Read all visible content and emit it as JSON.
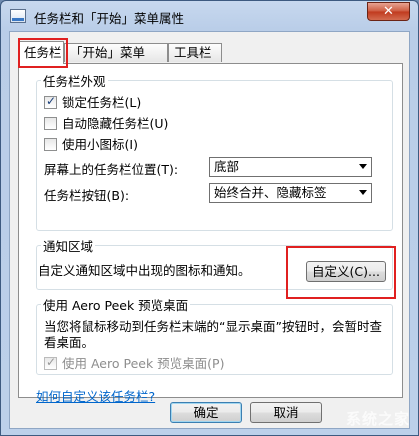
{
  "window": {
    "title": "任务栏和「开始」菜单属性",
    "close_glyph": "✕"
  },
  "tabs": [
    {
      "label": "任务栏",
      "active": true
    },
    {
      "label": "「开始」菜单",
      "active": false
    },
    {
      "label": "工具栏",
      "active": false
    }
  ],
  "appearance": {
    "title": "任务栏外观",
    "lock_taskbar": {
      "label": "锁定任务栏(L)",
      "checked": true
    },
    "auto_hide": {
      "label": "自动隐藏任务栏(U)",
      "checked": false
    },
    "small_icons": {
      "label": "使用小图标(I)",
      "checked": false
    },
    "location_label": "屏幕上的任务栏位置(T):",
    "location_value": "底部",
    "buttons_label": "任务栏按钮(B):",
    "buttons_value": "始终合并、隐藏标签"
  },
  "notification": {
    "title": "通知区域",
    "description": "自定义通知区域中出现的图标和通知。",
    "customize_button": "自定义(C)..."
  },
  "aero_peek": {
    "title": "使用 Aero Peek 预览桌面",
    "description": "当您将鼠标移动到任务栏末端的“显示桌面”按钮时，会暂时查看桌面。",
    "checkbox": {
      "label": "使用 Aero Peek 预览桌面(P)",
      "checked": true,
      "disabled": true
    }
  },
  "help_link": "如何自定义该任务栏?",
  "footer": {
    "ok_button": "确定",
    "cancel_button": "取消"
  },
  "watermark": "系统之家",
  "colors": {
    "highlight": "#e02020",
    "link": "#0066cc",
    "title_bar": "#b9cde8"
  }
}
